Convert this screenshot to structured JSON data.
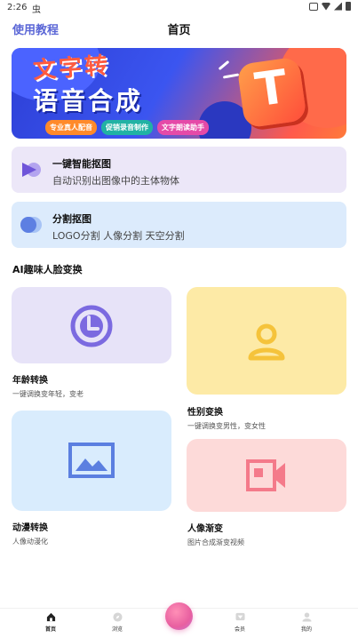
{
  "status_bar": {
    "time": "2:26",
    "app_icon": "虫"
  },
  "header": {
    "tutorial_link": "使用教程",
    "title": "首页"
  },
  "banner": {
    "title_line1": "文字转",
    "title_line2": "语音合成",
    "badge_letter": "T",
    "tags": [
      "专业真人配音",
      "促销录音制作",
      "文字朗读助手"
    ]
  },
  "features": [
    {
      "title": "一键智能抠图",
      "desc": "自动识别出图像中的主体物体",
      "icon": "play-triangle-icon"
    },
    {
      "title": "分割抠图",
      "desc": "LOGO分割 人像分割 天空分割",
      "icon": "toggle-icon"
    }
  ],
  "section": {
    "title": "AI趣味人脸变换"
  },
  "tiles": {
    "age": {
      "label": "年龄转换",
      "sub": "一键调换变年轻，变老",
      "icon": "clock-icon",
      "color": "#7b6ae0"
    },
    "gender": {
      "label": "性别变换",
      "sub": "一键调换变男性，变女性",
      "icon": "person-icon",
      "color": "#f5c33b"
    },
    "anime": {
      "label": "动漫转换",
      "sub": "人像动漫化",
      "icon": "image-icon",
      "color": "#5b7fe0"
    },
    "morph": {
      "label": "人像渐变",
      "sub": "图片合成渐变视频",
      "icon": "video-icon",
      "color": "#f47a8a"
    }
  },
  "bottom_nav": {
    "items": [
      {
        "label": "首页",
        "icon": "home-icon",
        "active": true
      },
      {
        "label": "浏览",
        "icon": "compass-icon",
        "active": false
      },
      {
        "label": "会员",
        "icon": "vip-icon",
        "active": false
      },
      {
        "label": "我的",
        "icon": "profile-icon",
        "active": false
      }
    ]
  }
}
